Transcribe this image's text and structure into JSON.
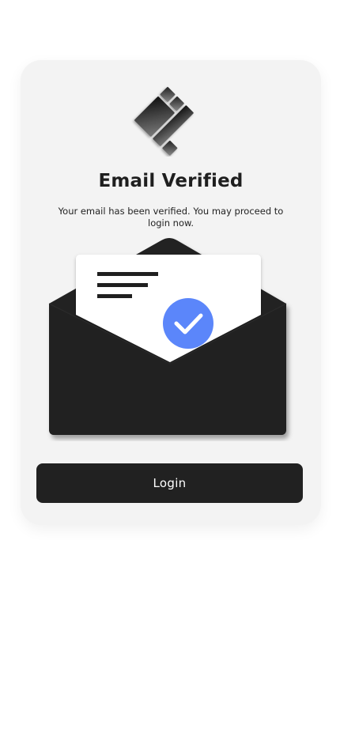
{
  "card": {
    "title": "Email Verified",
    "message": "Your email has been verified. You may proceed to login now."
  },
  "login_button": {
    "label": "Login"
  },
  "icons": {
    "logo": "diamond-tiles-logo",
    "illustration": "envelope-with-letter",
    "badge": "checkmark-circle-icon"
  },
  "colors": {
    "background": "#ffffff",
    "card": "#f3f3f3",
    "primary_dark": "#212121",
    "accent_blue": "#5b86fa",
    "button_text": "#ffffff"
  }
}
